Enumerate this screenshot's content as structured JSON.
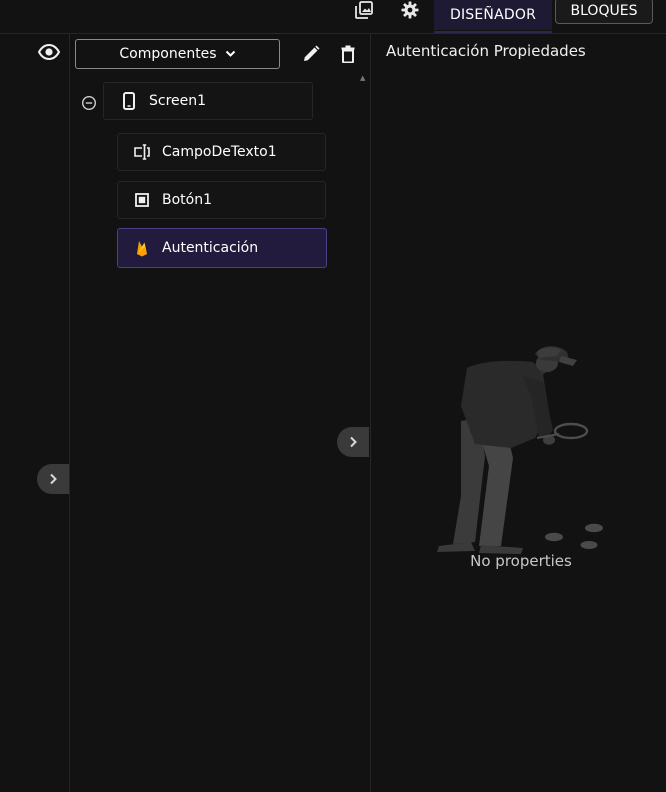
{
  "topbar": {
    "tabs": [
      {
        "label": "DISEÑADOR",
        "active": true
      },
      {
        "label": "BLOQUES",
        "active": false
      }
    ],
    "icons": [
      "gallery-icon",
      "gear-icon"
    ]
  },
  "left": {
    "icons": [
      "eye-icon",
      "chevron-right-icon"
    ]
  },
  "components": {
    "dropdown_label": "Componentes",
    "toolbar_icons": [
      "pencil-icon",
      "trash-icon"
    ],
    "tree": [
      {
        "label": "Screen1",
        "icon": "phone-icon",
        "level": 0,
        "expanded": true
      },
      {
        "label": "CampoDeTexto1",
        "icon": "textbox-icon",
        "level": 1
      },
      {
        "label": "Botón1",
        "icon": "button-icon",
        "level": 1
      },
      {
        "label": "Autenticación",
        "icon": "firebase-icon",
        "level": 1,
        "selected": true
      }
    ]
  },
  "properties": {
    "title": "Autenticación Propiedades",
    "empty_text": "No properties"
  },
  "colors": {
    "background": "#121212",
    "accent": "#221b3d",
    "accent_border": "#4a3f86",
    "firebase": "#f5b400"
  }
}
